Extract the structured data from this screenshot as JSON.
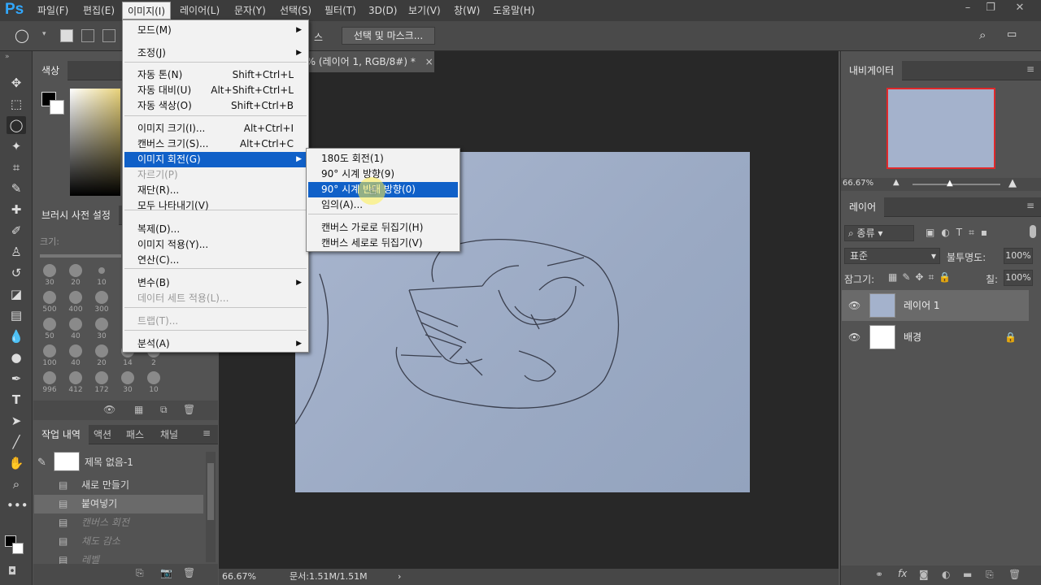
{
  "menubar": {
    "items": [
      "파일(F)",
      "편집(E)",
      "이미지(I)",
      "레이어(L)",
      "문자(Y)",
      "선택(S)",
      "필터(T)",
      "3D(D)",
      "보기(V)",
      "창(W)",
      "도움말(H)"
    ],
    "active": "이미지(I)"
  },
  "options_bar": {
    "select_mask_label": "선택 및 마스크...",
    "partial_label": "스"
  },
  "document": {
    "tab_title": "7% (레이어 1, RGB/8#) *",
    "close": "×"
  },
  "image_menu": {
    "items": [
      {
        "label": "모드(M)",
        "shortcut": "",
        "submenu": true,
        "disabled": false
      },
      {
        "label": "조정(J)",
        "shortcut": "",
        "submenu": true,
        "disabled": false
      },
      {
        "label": "자동 톤(N)",
        "shortcut": "Shift+Ctrl+L",
        "submenu": false,
        "disabled": false
      },
      {
        "label": "자동 대비(U)",
        "shortcut": "Alt+Shift+Ctrl+L",
        "submenu": false,
        "disabled": false
      },
      {
        "label": "자동 색상(O)",
        "shortcut": "Shift+Ctrl+B",
        "submenu": false,
        "disabled": false
      },
      {
        "label": "이미지 크기(I)...",
        "shortcut": "Alt+Ctrl+I",
        "submenu": false,
        "disabled": false
      },
      {
        "label": "캔버스 크기(S)...",
        "shortcut": "Alt+Ctrl+C",
        "submenu": false,
        "disabled": false
      },
      {
        "label": "이미지 회전(G)",
        "shortcut": "",
        "submenu": true,
        "disabled": false
      },
      {
        "label": "자르기(P)",
        "shortcut": "",
        "submenu": false,
        "disabled": true
      },
      {
        "label": "재단(R)...",
        "shortcut": "",
        "submenu": false,
        "disabled": false
      },
      {
        "label": "모두 나타내기(V)",
        "shortcut": "",
        "submenu": false,
        "disabled": false
      },
      {
        "label": "복제(D)...",
        "shortcut": "",
        "submenu": false,
        "disabled": false
      },
      {
        "label": "이미지 적용(Y)...",
        "shortcut": "",
        "submenu": false,
        "disabled": false
      },
      {
        "label": "연산(C)...",
        "shortcut": "",
        "submenu": false,
        "disabled": false
      },
      {
        "label": "변수(B)",
        "shortcut": "",
        "submenu": true,
        "disabled": false
      },
      {
        "label": "데이터 세트 적용(L)...",
        "shortcut": "",
        "submenu": false,
        "disabled": true
      },
      {
        "label": "트랩(T)...",
        "shortcut": "",
        "submenu": false,
        "disabled": true
      },
      {
        "label": "분석(A)",
        "shortcut": "",
        "submenu": true,
        "disabled": false
      }
    ]
  },
  "rotate_submenu": {
    "items": [
      "180도 회전(1)",
      "90° 시계 방향(9)",
      "90° 시계 반대 방향(0)",
      "임의(A)...",
      "캔버스 가로로 뒤집기(H)",
      "캔버스 세로로 뒤집기(V)"
    ],
    "highlighted": "90° 시계 반대 방향(0)"
  },
  "color_panel": {
    "tab": "색상"
  },
  "brush_panel": {
    "tab": "브러시 사전 설정",
    "size_label": "크기:",
    "brush_sizes": [
      "30",
      "20",
      "10",
      "",
      "",
      "500",
      "400",
      "300",
      "",
      "",
      "50",
      "40",
      "30",
      "",
      "",
      "100",
      "40",
      "20",
      "14",
      "2",
      "996",
      "412",
      "172",
      "30",
      "10"
    ]
  },
  "history_panel": {
    "tabs": [
      "작업 내역",
      "액션",
      "패스",
      "채널"
    ],
    "snapshot": "제목 없음-1",
    "items": [
      {
        "label": "새로 만들기",
        "state": "normal"
      },
      {
        "label": "붙여넣기",
        "state": "current"
      },
      {
        "label": "캔버스 회전",
        "state": "undone"
      },
      {
        "label": "채도 감소",
        "state": "undone"
      },
      {
        "label": "레벨",
        "state": "undone"
      }
    ]
  },
  "navigator_panel": {
    "tab": "내비게이터",
    "zoom": "66.67%"
  },
  "layers_panel": {
    "tab": "레이어",
    "filter_kind": "종류",
    "blend_mode": "표준",
    "opacity_label": "불투명도:",
    "opacity_value": "100%",
    "lock_label": "잠그기:",
    "fill_label": "칠:",
    "fill_value": "100%",
    "layers": [
      {
        "name": "레이어 1",
        "selected": true,
        "locked": false
      },
      {
        "name": "배경",
        "selected": false,
        "locked": true
      }
    ]
  },
  "status_bar": {
    "zoom": "66.67%",
    "doc_info": "문서:1.51M/1.51M"
  }
}
